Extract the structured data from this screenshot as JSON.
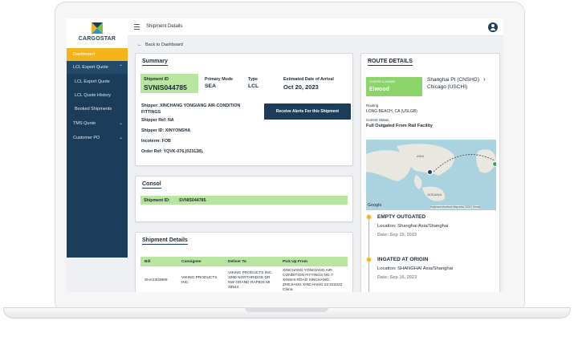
{
  "app": {
    "name": "CARGOSTAR",
    "page_title": "Shipment Details"
  },
  "colors": {
    "brand": "#1c3d5a",
    "accent": "#f3b41a",
    "highlight": "#b8e6a0"
  },
  "sidebar": {
    "items": [
      {
        "label": "Dashboard",
        "active": true
      },
      {
        "label": "LCL Export Quote",
        "expanded": true
      },
      {
        "label": "LCL Export Quote"
      },
      {
        "label": "LCL Quote History"
      },
      {
        "label": "Booked Shipments"
      },
      {
        "label": "TMS Quote"
      },
      {
        "label": "Customer PO"
      }
    ]
  },
  "nav": {
    "back_label": "Back to Dashboard"
  },
  "summary": {
    "title": "Summary",
    "shipment_id_label": "Shipment ID",
    "shipment_id": "SVNIS044785",
    "primary_mode_label": "Primary Mode",
    "primary_mode": "SEA",
    "type_label": "Type",
    "type": "LCL",
    "eta_label": "Estimated Date of Arrival",
    "eta": "Oct 20, 2023",
    "shipper": "Shipper: XINCHANG YONGIANG AIR-CONDITION FITTINGS",
    "shipper_ref": "Shipper Ref: NA",
    "shipper_id": "Shipper ID: XINYONSHA",
    "incoterm": "Incoterm: FOB",
    "order_ref": "Order Ref: YQVK-076,(023128),",
    "alert_button": "Receive Alerts For this Shipment"
  },
  "consol": {
    "title": "Consol",
    "shipment_id_label": "Shipment ID:",
    "shipment_id": "SVNIS044785"
  },
  "shipment_details": {
    "title": "Shipment Details",
    "columns": [
      "Bill",
      "Consignee",
      "Deliver To",
      "Pick Up From"
    ],
    "rows": [
      {
        "bill": "SHA2303969",
        "consignee": "VIKING PRODUCTS INC.",
        "deliver_to": "VIKING PRODUCTS INC. 3280 NORTHRIDGE DR NW GRAND RAPIDS MI 49544",
        "pick_up_from": "XINCHANG YONGIANG AIR-CONDITION FITTINGS NO.7 XINSHI ROAD XINCHANG, ZHEJIANG XINCHANG 22 222222 China"
      }
    ]
  },
  "route": {
    "title": "ROUTE DETAILS",
    "current_location_label": "Current Location",
    "current_location": "Elwood",
    "from": "Shanghai Pt (CNSHG)",
    "to": "Chicago (USCHI)",
    "routing_label": "Routing",
    "routing": "LONG BEACH, CA (USLGB)",
    "status_label": "Current Status",
    "status": "Full Outgated From Rail Facility",
    "map_labels": {
      "asia": "ASIA",
      "oceania": "OCEANIA",
      "google": "Google",
      "attribution": "Keyboard shortcuts   Map data ©2023   Terms"
    },
    "events": [
      {
        "title": "EMPTY OUTGATED",
        "location": "Location: Shanghai Asia/Shanghai",
        "date": "Date: Sep 15, 2023"
      },
      {
        "title": "INGATED AT ORIGIN",
        "location": "Location: SHANGHAI Asia/Shanghai",
        "date": "Date: Sep 16, 2023"
      }
    ]
  }
}
